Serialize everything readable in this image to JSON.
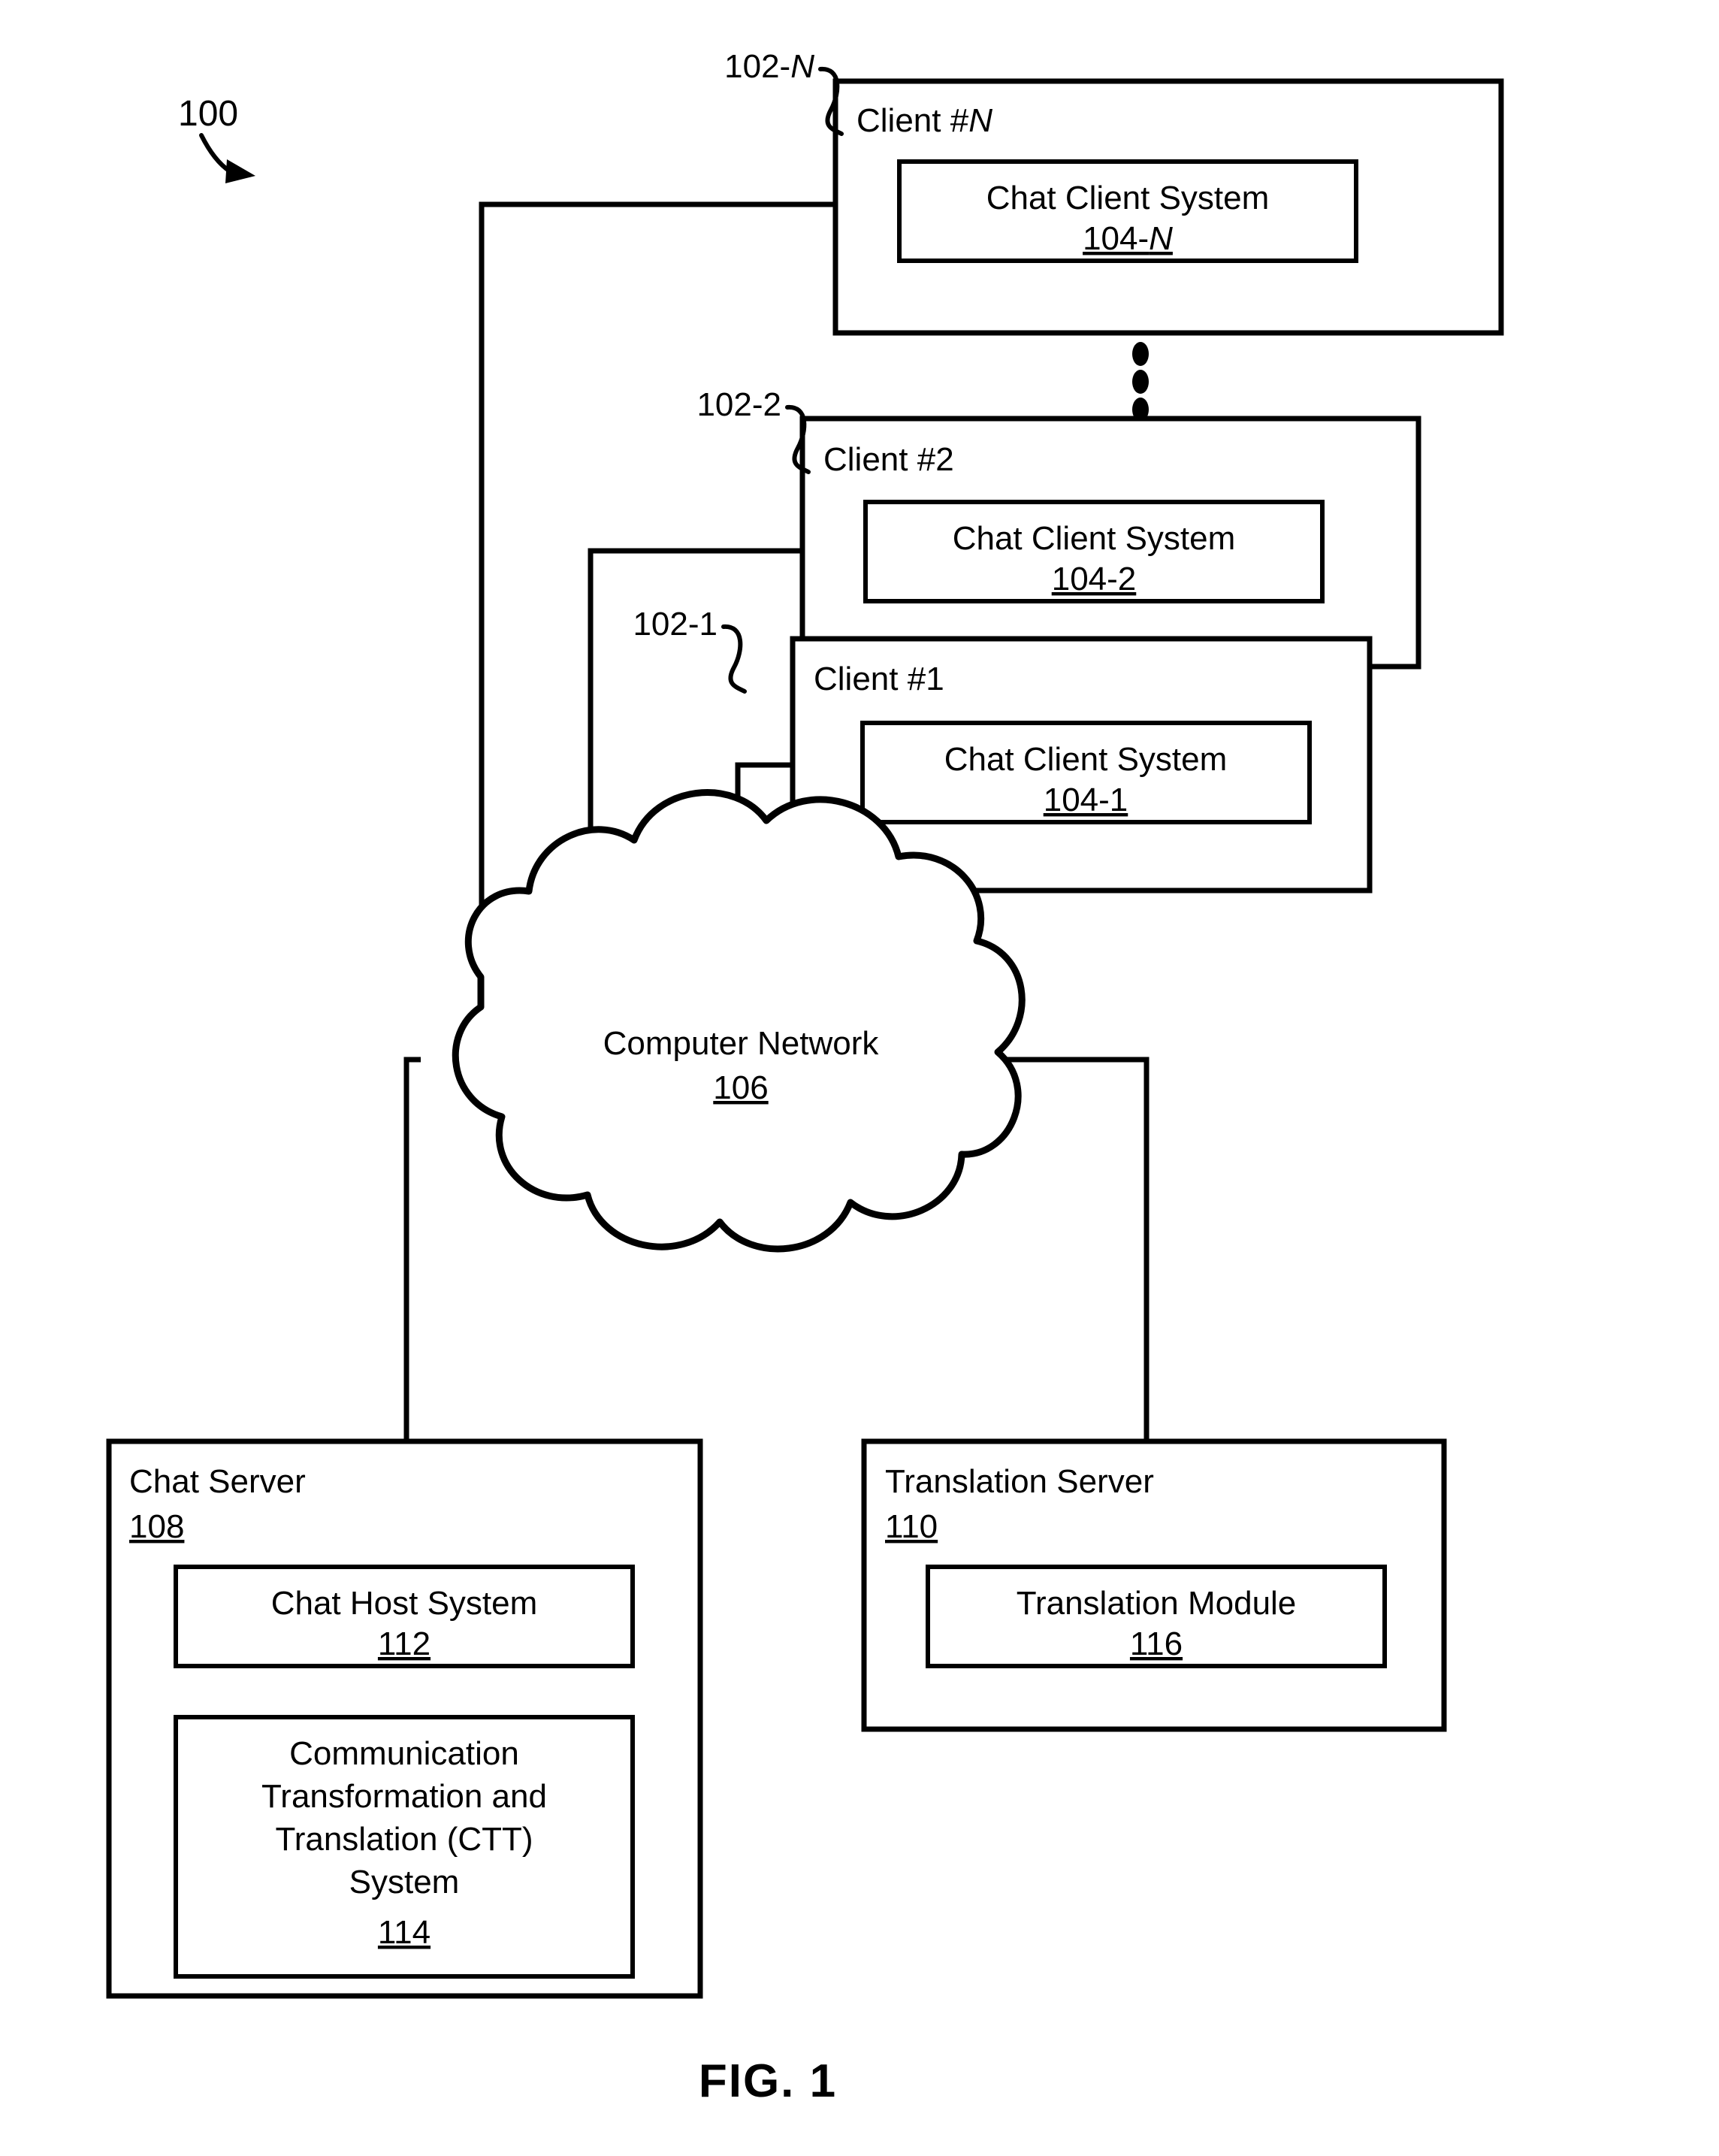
{
  "figure": {
    "caption": "FIG. 1",
    "system_ref": "100"
  },
  "callouts": {
    "client_n": "102-N",
    "client_2": "102-2",
    "client_1": "102-1"
  },
  "clients": [
    {
      "title": "Client #N",
      "title_prefix": "Client #",
      "title_suffix": "N",
      "module_label": "Chat Client System",
      "module_ref": "104-N",
      "module_ref_prefix": "104-",
      "module_ref_suffix": "N"
    },
    {
      "title": "Client #2",
      "title_prefix": "Client #",
      "title_suffix": "2",
      "module_label": "Chat Client System",
      "module_ref": "104-2",
      "module_ref_prefix": "104-",
      "module_ref_suffix": "2"
    },
    {
      "title": "Client #1",
      "title_prefix": "Client #",
      "title_suffix": "1",
      "module_label": "Chat Client System",
      "module_ref": "104-1",
      "module_ref_prefix": "104-",
      "module_ref_suffix": "1"
    }
  ],
  "network": {
    "label": "Computer Network",
    "ref": "106"
  },
  "chat_server": {
    "title": "Chat Server",
    "ref": "108",
    "modules": [
      {
        "label": "Chat Host System",
        "ref": "112",
        "lines": [
          "Chat Host System"
        ]
      },
      {
        "label": "Communication Transformation and Translation (CTT) System",
        "ref": "114",
        "lines": [
          "Communication",
          "Transformation and",
          "Translation (CTT)",
          "System"
        ]
      }
    ]
  },
  "translation_server": {
    "title": "Translation Server",
    "ref": "110",
    "modules": [
      {
        "label": "Translation Module",
        "ref": "116",
        "lines": [
          "Translation Module"
        ]
      }
    ]
  },
  "ellipsis": {
    "name": "vertical-ellipsis",
    "count": 3
  }
}
